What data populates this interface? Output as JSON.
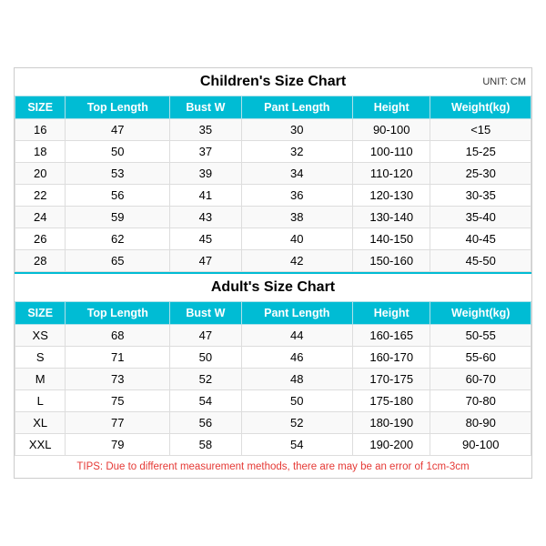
{
  "title": "Children's Size Chart",
  "unit": "UNIT: CM",
  "adult_title": "Adult's Size Chart",
  "tips": "TIPS: Due to different measurement methods, there are may be an error of 1cm-3cm",
  "headers": [
    "SIZE",
    "Top Length",
    "Bust W",
    "Pant Length",
    "Height",
    "Weight(kg)"
  ],
  "children_rows": [
    [
      "16",
      "47",
      "35",
      "30",
      "90-100",
      "<15"
    ],
    [
      "18",
      "50",
      "37",
      "32",
      "100-110",
      "15-25"
    ],
    [
      "20",
      "53",
      "39",
      "34",
      "110-120",
      "25-30"
    ],
    [
      "22",
      "56",
      "41",
      "36",
      "120-130",
      "30-35"
    ],
    [
      "24",
      "59",
      "43",
      "38",
      "130-140",
      "35-40"
    ],
    [
      "26",
      "62",
      "45",
      "40",
      "140-150",
      "40-45"
    ],
    [
      "28",
      "65",
      "47",
      "42",
      "150-160",
      "45-50"
    ]
  ],
  "adult_rows": [
    [
      "XS",
      "68",
      "47",
      "44",
      "160-165",
      "50-55"
    ],
    [
      "S",
      "71",
      "50",
      "46",
      "160-170",
      "55-60"
    ],
    [
      "M",
      "73",
      "52",
      "48",
      "170-175",
      "60-70"
    ],
    [
      "L",
      "75",
      "54",
      "50",
      "175-180",
      "70-80"
    ],
    [
      "XL",
      "77",
      "56",
      "52",
      "180-190",
      "80-90"
    ],
    [
      "XXL",
      "79",
      "58",
      "54",
      "190-200",
      "90-100"
    ]
  ]
}
